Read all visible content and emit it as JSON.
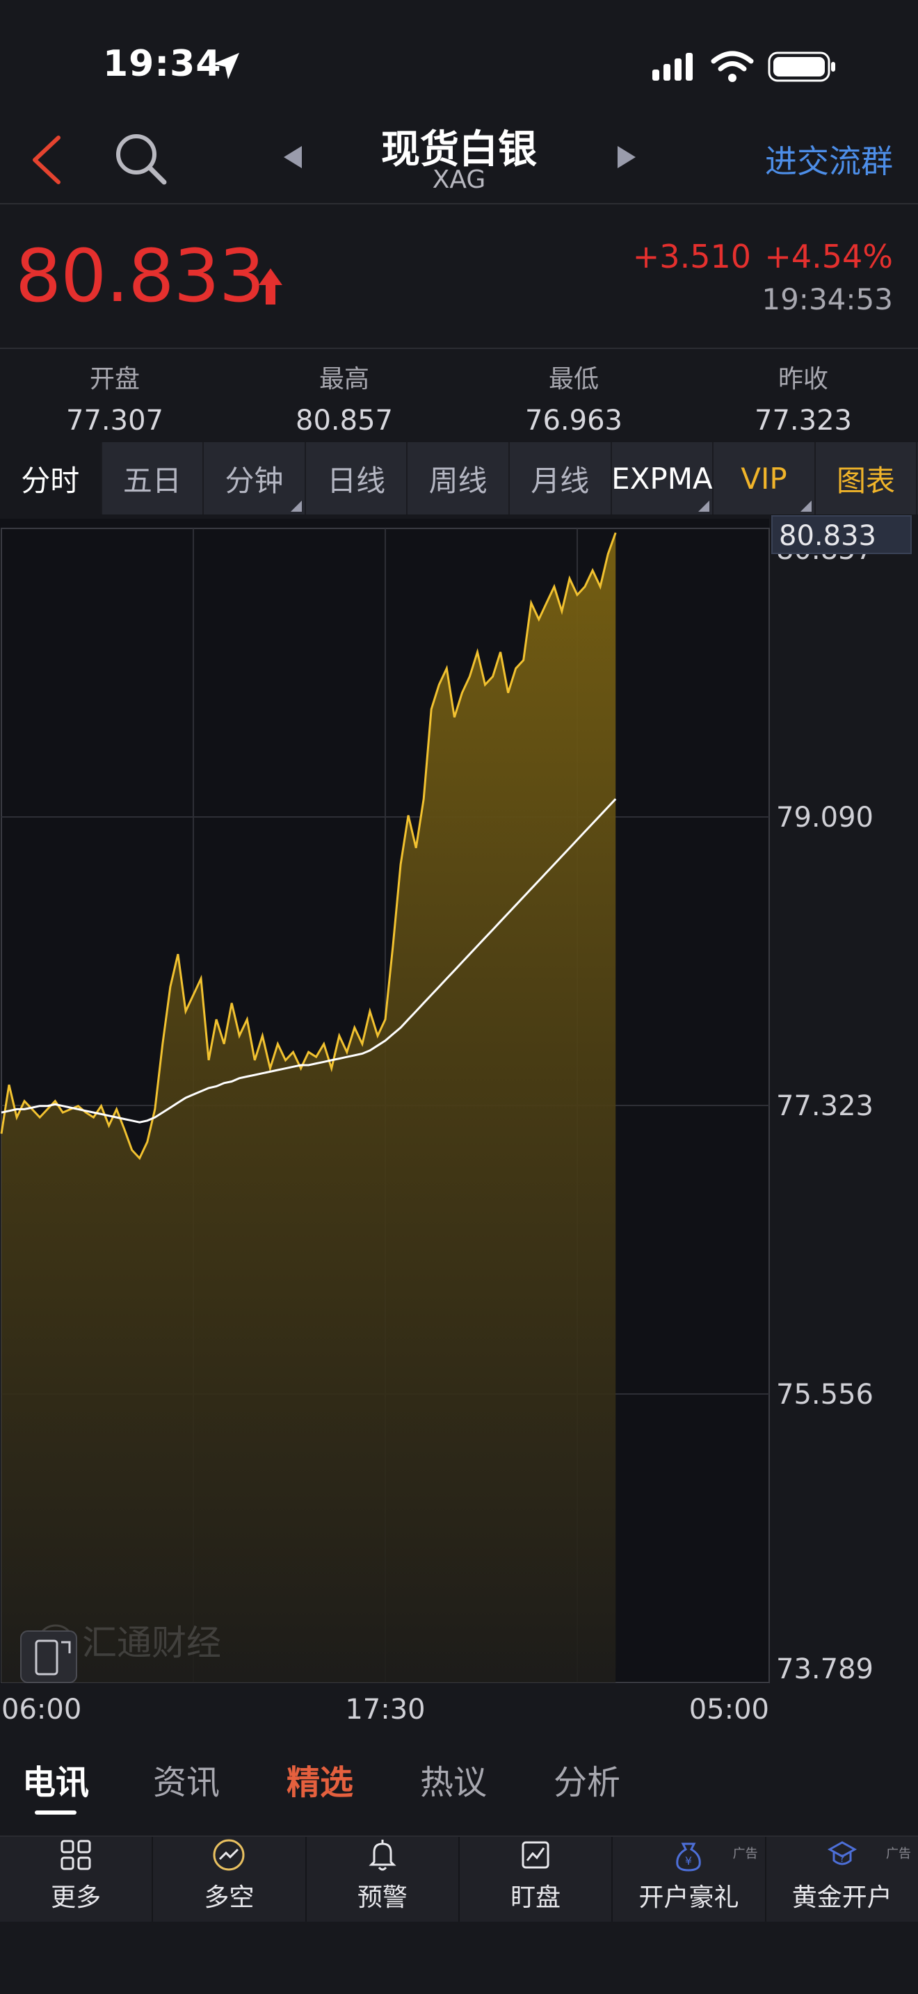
{
  "status_bar": {
    "time": "19:34"
  },
  "header": {
    "title": "现货白银",
    "subtitle": "XAG",
    "group_link": "进交流群"
  },
  "quote": {
    "price": "80.833",
    "change": "+3.510",
    "change_pct": "+4.54%",
    "time": "19:34:53",
    "open_label": "开盘",
    "open": "77.307",
    "high_label": "最高",
    "high": "80.857",
    "low_label": "最低",
    "low": "76.963",
    "prev_close_label": "昨收",
    "prev_close": "77.323"
  },
  "period_tabs": [
    "分时",
    "五日",
    "分钟",
    "日线",
    "周线",
    "月线",
    "EXPMA",
    "VIP",
    "图表"
  ],
  "chart_data": {
    "type": "area",
    "y_ticks": [
      "80.857",
      "79.090",
      "77.323",
      "75.556",
      "73.789"
    ],
    "ylim": [
      73.789,
      80.857
    ],
    "x_ticks": [
      "06:00",
      "17:30",
      "05:00"
    ],
    "last_price_label": "80.833",
    "watermark": "汇通财经",
    "series": [
      {
        "values": [
          77.15,
          77.45,
          77.25,
          77.35,
          77.3,
          77.25,
          77.3,
          77.35,
          77.28,
          77.3,
          77.32,
          77.28,
          77.25,
          77.32,
          77.2,
          77.3,
          77.18,
          77.05,
          77.0,
          77.1,
          77.3,
          77.7,
          78.05,
          78.25,
          77.9,
          78.0,
          78.1,
          77.6,
          77.85,
          77.7,
          77.95,
          77.75,
          77.85,
          77.6,
          77.75,
          77.55,
          77.7,
          77.6,
          77.65,
          77.55,
          77.65,
          77.62,
          77.7,
          77.55,
          77.75,
          77.65,
          77.8,
          77.7,
          77.9,
          77.75,
          77.85,
          78.3,
          78.8,
          79.1,
          78.9,
          79.2,
          79.75,
          79.9,
          80.0,
          79.7,
          79.85,
          79.95,
          80.1,
          79.9,
          79.95,
          80.1,
          79.85,
          80.0,
          80.05,
          80.4,
          80.3,
          80.4,
          80.5,
          80.35,
          80.55,
          80.45,
          80.5,
          80.6,
          80.5,
          80.7,
          80.83
        ]
      },
      {
        "values": [
          77.28,
          77.29,
          77.3,
          77.3,
          77.31,
          77.32,
          77.32,
          77.33,
          77.32,
          77.31,
          77.3,
          77.29,
          77.28,
          77.27,
          77.26,
          77.25,
          77.24,
          77.23,
          77.22,
          77.23,
          77.25,
          77.28,
          77.31,
          77.34,
          77.37,
          77.39,
          77.41,
          77.43,
          77.44,
          77.46,
          77.47,
          77.49,
          77.5,
          77.51,
          77.52,
          77.53,
          77.54,
          77.55,
          77.56,
          77.57,
          77.57,
          77.58,
          77.59,
          77.6,
          77.61,
          77.62,
          77.63,
          77.64,
          77.66,
          77.69,
          77.72,
          77.76,
          77.8,
          77.85,
          77.9,
          77.95,
          78.0,
          78.05,
          78.1,
          78.15,
          78.2,
          78.25,
          78.3,
          78.35,
          78.4,
          78.45,
          78.5,
          78.55,
          78.6,
          78.65,
          78.7,
          78.75,
          78.8,
          78.85,
          78.9,
          78.95,
          79.0,
          79.05,
          79.1,
          79.15,
          79.2
        ]
      }
    ]
  },
  "news_tabs": [
    "电讯",
    "资讯",
    "精选",
    "热议",
    "分析"
  ],
  "toolbar": [
    {
      "label": "更多",
      "icon": "grid-icon"
    },
    {
      "label": "多空",
      "icon": "trend-icon"
    },
    {
      "label": "预警",
      "icon": "bell-icon"
    },
    {
      "label": "盯盘",
      "icon": "monitor-chart-icon"
    },
    {
      "label": "开户豪礼",
      "icon": "gift-bag-icon",
      "ad": "广告"
    },
    {
      "label": "黄金开户",
      "icon": "gold-account-icon",
      "ad": "广告"
    }
  ],
  "colors": {
    "up": "#e5302e",
    "gold": "#f0b42a",
    "link": "#4d8ee8",
    "line": "#f2c230",
    "avg": "#ffffff"
  }
}
